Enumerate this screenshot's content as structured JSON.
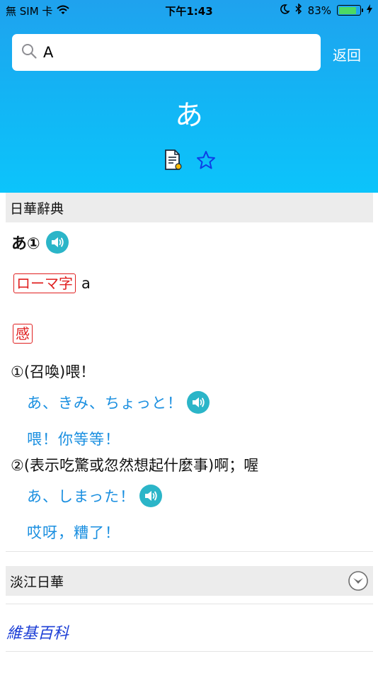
{
  "status": {
    "carrier": "無 SIM 卡",
    "time": "下午1:43",
    "battery": "83%",
    "battery_level": 0.83
  },
  "search": {
    "value": "A"
  },
  "back_label": "返回",
  "headword": "あ",
  "sections": {
    "primary": {
      "title": "日華辭典",
      "entry_title": "あ①",
      "romaji_tag": "ローマ字",
      "romaji_value": "a",
      "pos_tag": "感",
      "senses": [
        {
          "definition": "①(召喚)喂！",
          "example": "あ、きみ、ちょっと！",
          "translation": "喂！你等等！"
        },
        {
          "definition": "②(表示吃驚或忽然想起什麼事)啊；喔",
          "example": "あ、しまった！",
          "translation": "哎呀，糟了！"
        }
      ]
    },
    "secondary": {
      "title": "淡江日華"
    },
    "wiki_link": "維基百科"
  },
  "colors": {
    "header_gradient_top": "#1fa2ee",
    "header_gradient_bottom": "#0cc4fb",
    "example_text": "#1a8fe0",
    "tag_red": "#e02020",
    "speaker_teal": "#2bb5c8",
    "wiki_link": "#1d3fd6"
  }
}
